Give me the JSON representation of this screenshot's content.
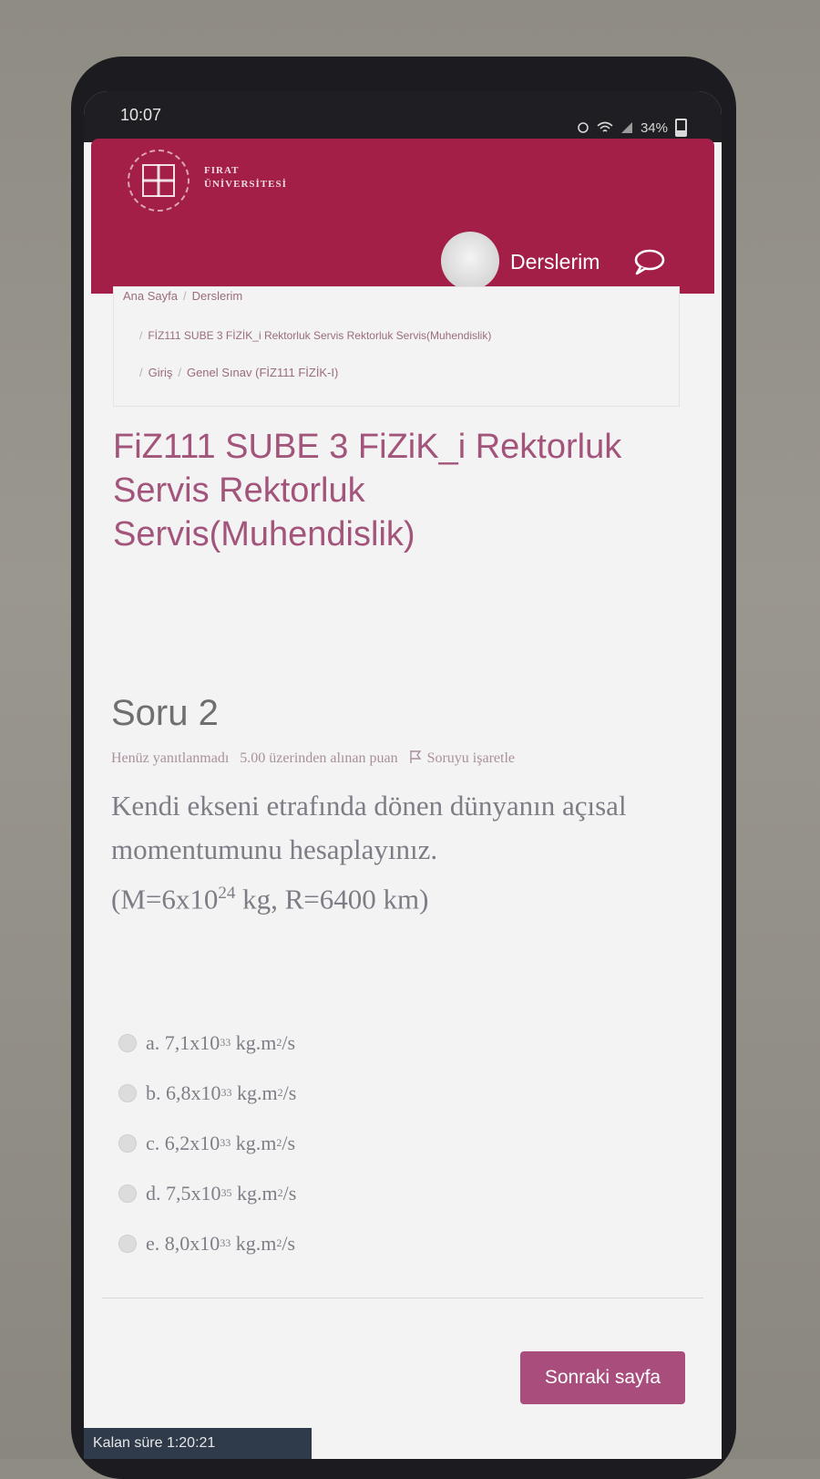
{
  "status_bar": {
    "time": "10:07",
    "battery": "34%"
  },
  "header": {
    "logo_line1": "FIRAT",
    "logo_line2": "ÜNİVERSİTESİ",
    "nav_link": "Derslerim"
  },
  "breadcrumb": {
    "home": "Ana Sayfa",
    "courses": "Derslerim",
    "course": "FİZ111 SUBE 3 FİZİK_i Rektorluk Servis Rektorluk Servis(Muhendislik)",
    "intro": "Giriş",
    "exam": "Genel Sınav (FİZ111 FİZİK-I)"
  },
  "course_title": "FiZ111 SUBE 3 FiZiK_i Rektorluk Servis Rektorluk Servis(Muhendislik)",
  "question": {
    "title": "Soru 2",
    "status": "Henüz yanıtlanmadı",
    "points": "5.00 üzerinden alınan puan",
    "flag_label": "Soruyu işaretle",
    "text_line1": "Kendi ekseni etrafında dönen dünyanın açısal momentumunu hesaplayınız.",
    "text_given_prefix": "(M=6x10",
    "text_given_exp": "24",
    "text_given_suffix": " kg, R=6400 km)"
  },
  "options": [
    {
      "letter": "a.",
      "mantissa": "7,1x10",
      "exp": "33",
      "unit": "kg.m",
      "unit_exp": "2",
      "unit_tail": "/s"
    },
    {
      "letter": "b.",
      "mantissa": "6,8x10",
      "exp": "33",
      "unit": "kg.m",
      "unit_exp": "2",
      "unit_tail": "/s"
    },
    {
      "letter": "c.",
      "mantissa": "6,2x10",
      "exp": "33",
      "unit": "kg.m",
      "unit_exp": "2",
      "unit_tail": "/s"
    },
    {
      "letter": "d.",
      "mantissa": "7,5x10",
      "exp": "35",
      "unit": "kg.m",
      "unit_exp": "2",
      "unit_tail": "/s"
    },
    {
      "letter": "e.",
      "mantissa": "8,0x10",
      "exp": "33",
      "unit": "kg.m",
      "unit_exp": "2",
      "unit_tail": "/s"
    }
  ],
  "next_button": "Sonraki sayfa",
  "timer_text": "Kalan süre 1:20:21",
  "colors": {
    "brand": "#a31f48",
    "button": "#a84d7c",
    "title": "#a3547a"
  }
}
